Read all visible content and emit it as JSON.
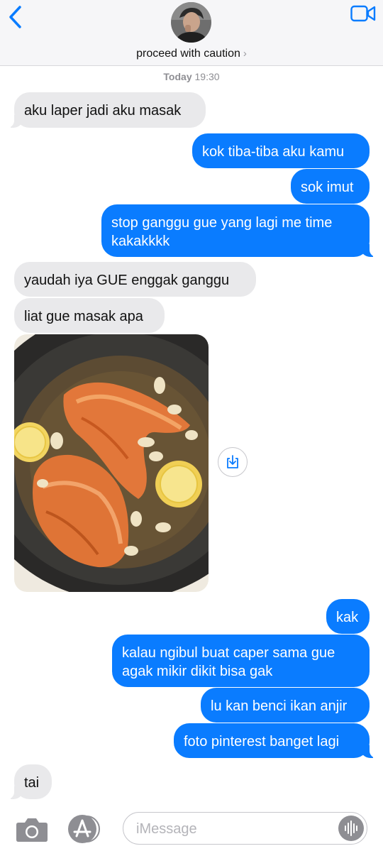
{
  "header": {
    "contact_name": "proceed with caution",
    "chevron": "›",
    "back_icon": "chevron-left-icon",
    "video_icon": "video-camera-icon",
    "accent": "#0a7cff"
  },
  "timestamp": {
    "day": "Today",
    "time": "19:30"
  },
  "messages": [
    {
      "dir": "in",
      "lines": [
        "aku laper jadi aku masak"
      ]
    },
    {
      "dir": "out",
      "lines": [
        "kok tiba-tiba aku kamu"
      ]
    },
    {
      "dir": "out",
      "lines": [
        "sok imut"
      ]
    },
    {
      "dir": "out",
      "lines": [
        "stop ganggu gue yang lagi me time",
        "kakakkkk"
      ]
    },
    {
      "dir": "in",
      "lines": [
        "yaudah iya GUE enggak ganggu"
      ]
    },
    {
      "dir": "in",
      "lines": [
        "liat gue masak apa"
      ]
    },
    {
      "dir": "in",
      "type": "photo",
      "description_icon": "photo-salmon"
    },
    {
      "dir": "out",
      "lines": [
        "kak"
      ]
    },
    {
      "dir": "out",
      "lines": [
        "kalau ngibul buat caper sama gue",
        "agak mikir dikit bisa gak"
      ]
    },
    {
      "dir": "out",
      "lines": [
        "lu kan benci ikan anjir"
      ]
    },
    {
      "dir": "out",
      "lines": [
        "foto pinterest banget lagi"
      ]
    },
    {
      "dir": "in",
      "lines": [
        "tai"
      ]
    }
  ],
  "composer": {
    "placeholder": "iMessage",
    "camera_icon": "camera-icon",
    "apps_icon": "app-store-icon",
    "audio_icon": "audio-waveform-icon"
  },
  "colors": {
    "incoming": "#e9e9eb",
    "outgoing": "#0a7cff",
    "header_bg": "#f6f6f8"
  }
}
